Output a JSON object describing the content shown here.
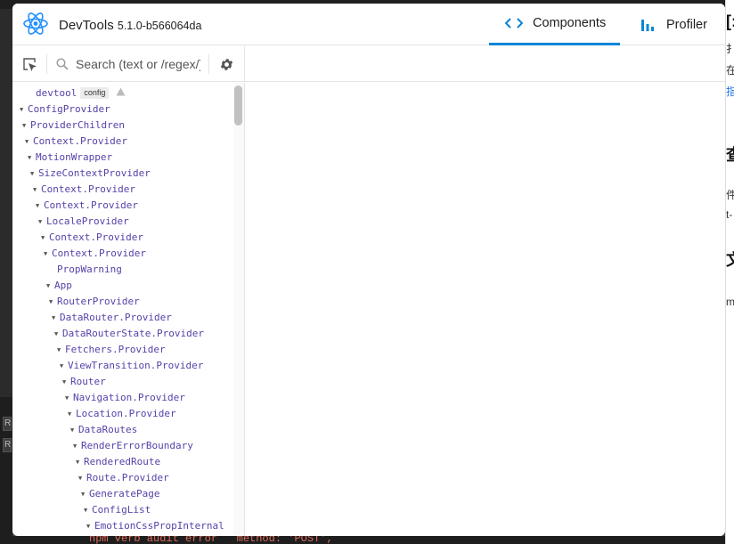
{
  "app": {
    "name": "DevTools",
    "version": "5.1.0-b566064da"
  },
  "tabs": [
    {
      "label": "Components",
      "icon": "code-brackets-icon",
      "active": true
    },
    {
      "label": "Profiler",
      "icon": "bar-chart-icon",
      "active": false
    }
  ],
  "search": {
    "placeholder": "Search (text or /regex/)",
    "value": ""
  },
  "colors": {
    "accent": "#0a84d6",
    "component_name": "#5741a8",
    "react_logo": "#1e90ff"
  },
  "tree": [
    {
      "name": "devtool",
      "expanded": null,
      "depth": 0,
      "badge": "config",
      "warning": true
    },
    {
      "name": "ConfigProvider",
      "expanded": true,
      "depth": 1
    },
    {
      "name": "ProviderChildren",
      "expanded": true,
      "depth": 2
    },
    {
      "name": "Context.Provider",
      "expanded": true,
      "depth": 3
    },
    {
      "name": "MotionWrapper",
      "expanded": true,
      "depth": 4
    },
    {
      "name": "SizeContextProvider",
      "expanded": true,
      "depth": 5
    },
    {
      "name": "Context.Provider",
      "expanded": true,
      "depth": 6
    },
    {
      "name": "Context.Provider",
      "expanded": true,
      "depth": 7
    },
    {
      "name": "LocaleProvider",
      "expanded": true,
      "depth": 8
    },
    {
      "name": "Context.Provider",
      "expanded": true,
      "depth": 9
    },
    {
      "name": "Context.Provider",
      "expanded": true,
      "depth": 10
    },
    {
      "name": "PropWarning",
      "expanded": null,
      "depth": 11
    },
    {
      "name": "App",
      "expanded": true,
      "depth": 11
    },
    {
      "name": "RouterProvider",
      "expanded": true,
      "depth": 12
    },
    {
      "name": "DataRouter.Provider",
      "expanded": true,
      "depth": 13
    },
    {
      "name": "DataRouterState.Provider",
      "expanded": true,
      "depth": 14
    },
    {
      "name": "Fetchers.Provider",
      "expanded": true,
      "depth": 15
    },
    {
      "name": "ViewTransition.Provider",
      "expanded": true,
      "depth": 16
    },
    {
      "name": "Router",
      "expanded": true,
      "depth": 17
    },
    {
      "name": "Navigation.Provider",
      "expanded": true,
      "depth": 18
    },
    {
      "name": "Location.Provider",
      "expanded": true,
      "depth": 19
    },
    {
      "name": "DataRoutes",
      "expanded": true,
      "depth": 20
    },
    {
      "name": "RenderErrorBoundary",
      "expanded": true,
      "depth": 21
    },
    {
      "name": "RenderedRoute",
      "expanded": true,
      "depth": 22
    },
    {
      "name": "Route.Provider",
      "expanded": true,
      "depth": 23
    },
    {
      "name": "GeneratePage",
      "expanded": true,
      "depth": 24
    },
    {
      "name": "ConfigList",
      "expanded": true,
      "depth": 25
    },
    {
      "name": "EmotionCssPropInternal",
      "expanded": true,
      "depth": 26
    }
  ],
  "background": {
    "left_buttons": [
      "R",
      "R"
    ],
    "bottom_log": "npm verb audit error   method: 'POST',",
    "right_fragments": [
      "[:",
      "扌",
      "在",
      "指",
      "查",
      "件",
      "t-",
      "文",
      "m"
    ]
  }
}
